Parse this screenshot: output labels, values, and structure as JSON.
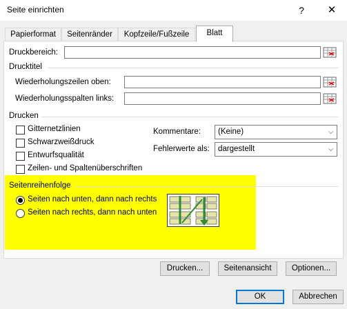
{
  "window": {
    "title": "Seite einrichten",
    "help_glyph": "?",
    "close_glyph": "✕"
  },
  "tabs": [
    {
      "label": "Papierformat",
      "active": false
    },
    {
      "label": "Seitenränder",
      "active": false
    },
    {
      "label": "Kopfzeile/Fußzeile",
      "active": false
    },
    {
      "label": "Blatt",
      "active": true
    }
  ],
  "print_area": {
    "label": "Druckbereich:",
    "value": ""
  },
  "print_titles": {
    "group_label": "Drucktitel",
    "rows_label": "Wiederholungszeilen oben:",
    "rows_value": "",
    "cols_label": "Wiederholungsspalten links:",
    "cols_value": ""
  },
  "print": {
    "group_label": "Drucken",
    "checkboxes": [
      {
        "label": "Gitternetzlinien",
        "checked": false
      },
      {
        "label": "Schwarzweißdruck",
        "checked": false
      },
      {
        "label": "Entwurfsqualität",
        "checked": false
      },
      {
        "label": "Zeilen- und Spaltenüberschriften",
        "checked": false
      }
    ],
    "comments_label": "Kommentare:",
    "comments_value": "(Keine)",
    "errors_label": "Fehlerwerte als:",
    "errors_value": "dargestellt"
  },
  "page_order": {
    "group_label": "Seitenreihenfolge",
    "options": [
      {
        "label": "Seiten nach unten, dann nach rechts",
        "selected": true
      },
      {
        "label": "Seiten nach rechts, dann nach unten",
        "selected": false
      }
    ],
    "highlight_color": "#ffff00"
  },
  "buttons": {
    "print": "Drucken...",
    "preview": "Seitenansicht",
    "options": "Optionen...",
    "ok": "OK",
    "cancel": "Abbrechen"
  },
  "colors": {
    "accent": "#0078d7",
    "dialog_bg": "#f0f0f0",
    "preview_arrow": "#2e8b2e"
  }
}
